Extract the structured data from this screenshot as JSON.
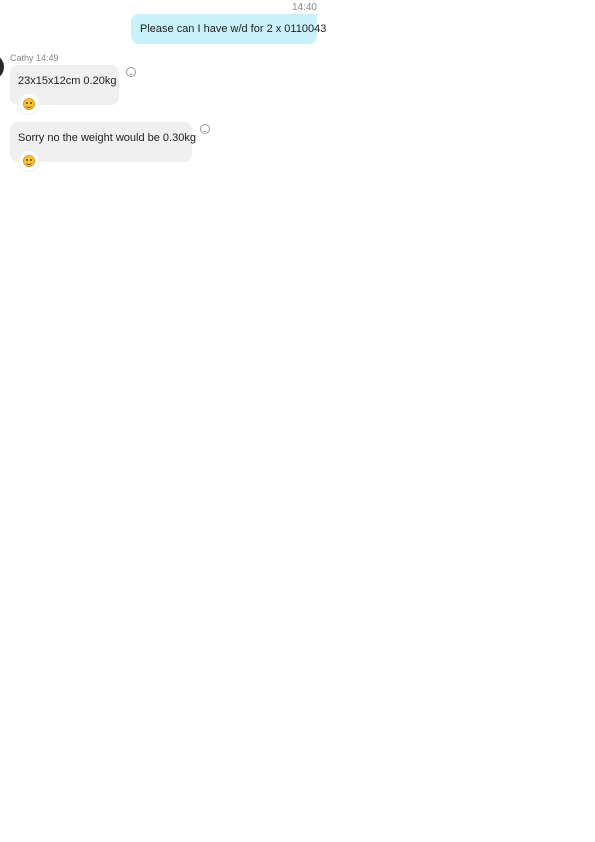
{
  "messages": {
    "outgoing": {
      "time": "14:40",
      "text": "Please can I have w/d for 2 x 0110043"
    },
    "incoming_header": {
      "sender": "Cathy",
      "time": "14:49"
    },
    "incoming": [
      {
        "text": "23x15x12cm  0.20kg",
        "reaction_icon": "smiley-icon"
      },
      {
        "text": "Sorry no the weight would be 0.30kg",
        "reaction_icon": "smiley-icon"
      }
    ]
  },
  "colors": {
    "outgoing_bubble": "#c9f1f9",
    "incoming_bubble": "#f0f0f0",
    "timestamp": "#8a8a8a"
  }
}
